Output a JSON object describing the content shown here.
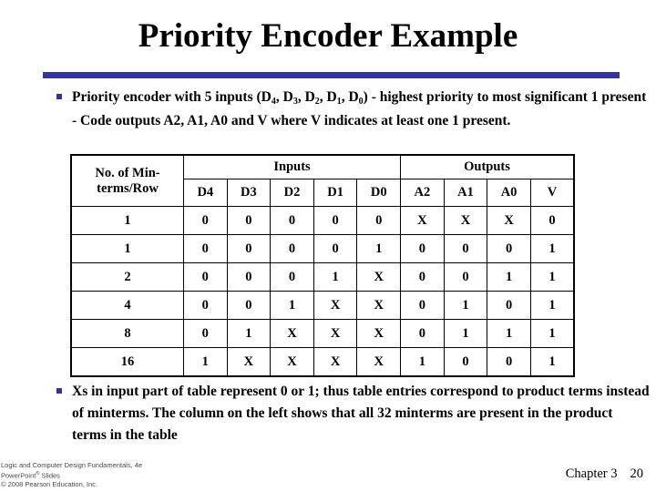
{
  "slide": {
    "title": "Priority Encoder Example",
    "accent_color": "#3333a8",
    "bullet_color": "#33339a"
  },
  "bullets": {
    "top": {
      "segments": [
        {
          "t": "Priority encoder with 5 inputs (D"
        },
        {
          "sub": "4"
        },
        {
          "t": ", D"
        },
        {
          "sub": "3"
        },
        {
          "t": ", D"
        },
        {
          "sub": "2"
        },
        {
          "t": ", D"
        },
        {
          "sub": "1"
        },
        {
          "t": ", D"
        },
        {
          "sub": "0"
        },
        {
          "t": ") - highest priority to most significant 1 present - Code outputs A2, A1, A0 and V where V indicates at least one 1 present."
        }
      ]
    },
    "bottom": {
      "text": "Xs in input part of table represent 0 or 1; thus table entries correspond to product terms instead of minterms. The column on the left shows that all 32 minterms are present in the product terms in the table"
    }
  },
  "table": {
    "row_header_line1": "No. of Min-",
    "row_header_line2": "terms/Row",
    "group_inputs": "Inputs",
    "group_outputs": "Outputs",
    "input_columns": [
      "D4",
      "D3",
      "D2",
      "D1",
      "D0"
    ],
    "output_columns": [
      "A2",
      "A1",
      "A0",
      "V"
    ],
    "rows": [
      {
        "minterms": "1",
        "inputs": [
          "0",
          "0",
          "0",
          "0",
          "0"
        ],
        "outputs": [
          "X",
          "X",
          "X",
          "0"
        ]
      },
      {
        "minterms": "1",
        "inputs": [
          "0",
          "0",
          "0",
          "0",
          "1"
        ],
        "outputs": [
          "0",
          "0",
          "0",
          "1"
        ]
      },
      {
        "minterms": "2",
        "inputs": [
          "0",
          "0",
          "0",
          "1",
          "X"
        ],
        "outputs": [
          "0",
          "0",
          "1",
          "1"
        ]
      },
      {
        "minterms": "4",
        "inputs": [
          "0",
          "0",
          "1",
          "X",
          "X"
        ],
        "outputs": [
          "0",
          "1",
          "0",
          "1"
        ]
      },
      {
        "minterms": "8",
        "inputs": [
          "0",
          "1",
          "X",
          "X",
          "X"
        ],
        "outputs": [
          "0",
          "1",
          "1",
          "1"
        ]
      },
      {
        "minterms": "16",
        "inputs": [
          "1",
          "X",
          "X",
          "X",
          "X"
        ],
        "outputs": [
          "1",
          "0",
          "0",
          "1"
        ]
      }
    ]
  },
  "footer": {
    "credit_line1": "Logic and Computer Design Fundamentals, 4e",
    "credit_line2_main": "PowerPoint",
    "credit_line2_sup": "®",
    "credit_line2_tail": " Slides",
    "credit_line3": "© 2008 Pearson Education, Inc.",
    "chapter": "Chapter 3",
    "page_number": "20"
  }
}
